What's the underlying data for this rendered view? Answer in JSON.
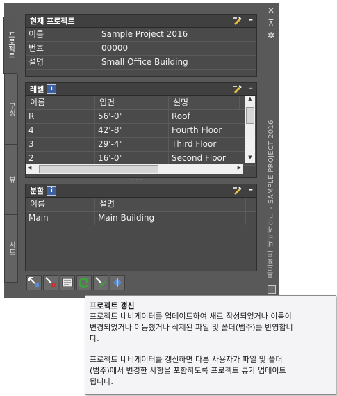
{
  "window": {
    "close_glyph": "✕",
    "dock_glyph": "⊼",
    "settings_glyph": "✲",
    "vertical_title": "프로젝트 네비게이터 - SAMPLE PROJECT 2016"
  },
  "tabs": [
    {
      "label": "프로젝트",
      "active": true
    },
    {
      "label": "구성",
      "active": false
    },
    {
      "label": "뷰",
      "active": false
    },
    {
      "label": "시트",
      "active": false
    }
  ],
  "current_project": {
    "title": "현재 프로젝트",
    "rows": [
      {
        "key": "이름",
        "value": "Sample Project 2016"
      },
      {
        "key": "번호",
        "value": "00000"
      },
      {
        "key": "설명",
        "value": "Small Office Building"
      }
    ]
  },
  "levels": {
    "title": "레벨",
    "info_glyph": "i",
    "columns": [
      "이름",
      "입면",
      "설명"
    ],
    "rows": [
      {
        "name": "R",
        "elev": "56'-0\"",
        "desc": "Roof"
      },
      {
        "name": "4",
        "elev": "42'-8\"",
        "desc": "Fourth Floor"
      },
      {
        "name": "3",
        "elev": "29'-4\"",
        "desc": "Third Floor"
      },
      {
        "name": "2",
        "elev": "16'-0\"",
        "desc": "Second Floor"
      }
    ]
  },
  "divisions": {
    "title": "분할",
    "info_glyph": "i",
    "columns": [
      "이름",
      "설명"
    ],
    "rows": [
      {
        "name": "Main",
        "desc": "Main Building"
      }
    ]
  },
  "toolbar": {
    "buttons": [
      "add-project-icon",
      "remove-icon",
      "properties-icon",
      "refresh-icon",
      "repath-icon",
      "publish-icon"
    ]
  },
  "tooltip": {
    "title": "프로젝트 갱신",
    "line1": "프로젝트 네비게이터를 업데이트하여 새로 작성되었거나 이름이",
    "line2": "변경되었거나 이동했거나 삭제된 파일 및 폴더(범주)를 반영합니",
    "line3": "다.",
    "line4": "프로젝트 네비게이터를 갱신하면 다른 사용자가 파일 및 폴더",
    "line5": "(범주)에서 변경한 사항을 포함하도록 프로젝트 뷰가 업데이트",
    "line6": "됩니다."
  },
  "colors": {
    "panel": "#595959",
    "header": "#404040",
    "refresh_green": "#3aa63a"
  }
}
